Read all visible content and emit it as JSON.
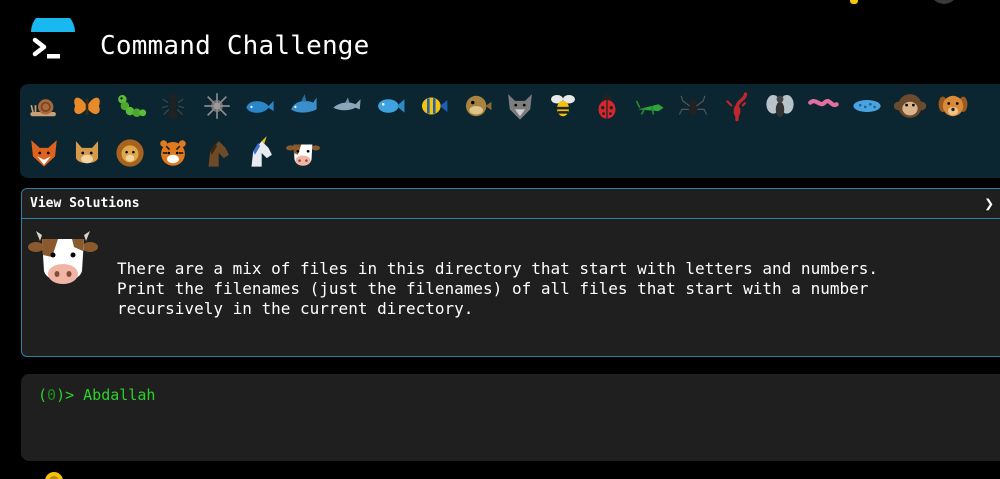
{
  "header": {
    "title": "Command Challenge",
    "logo_icon": "terminal-prompt-icon",
    "accent_color": "#19b8f0"
  },
  "challenges": {
    "icons": [
      "snail-icon",
      "butterfly-icon",
      "caterpillar-icon",
      "ant-icon",
      "sea-urchin-icon",
      "whale-icon",
      "shark-icon",
      "dolphin-icon",
      "fish-icon",
      "tropical-fish-icon",
      "pufferfish-icon",
      "wolf-icon",
      "bee-icon",
      "ladybug-icon",
      "cricket-icon",
      "spider-icon",
      "scorpion-icon",
      "fly-icon",
      "worm-icon",
      "microbe-icon",
      "monkey-icon",
      "dog-icon",
      "fox-icon",
      "cat-icon",
      "lion-icon",
      "tiger-icon",
      "horse-icon",
      "unicorn-icon",
      "cow-icon"
    ],
    "strip_color": "#0b2630"
  },
  "solutions": {
    "label": "View Solutions",
    "arrow": "❯",
    "current_icon": "cow-icon",
    "description": "There are a mix of files in this directory that start with letters and numbers.\nPrint the filenames (just the filenames) of all files that start with a number\nrecursively in the current directory.",
    "border_color": "#2e7fa8"
  },
  "terminal": {
    "prompt_open": "(",
    "prompt_code": "0",
    "prompt_close": ")> ",
    "input": "Abdallah",
    "text_color": "#2ad12a"
  }
}
